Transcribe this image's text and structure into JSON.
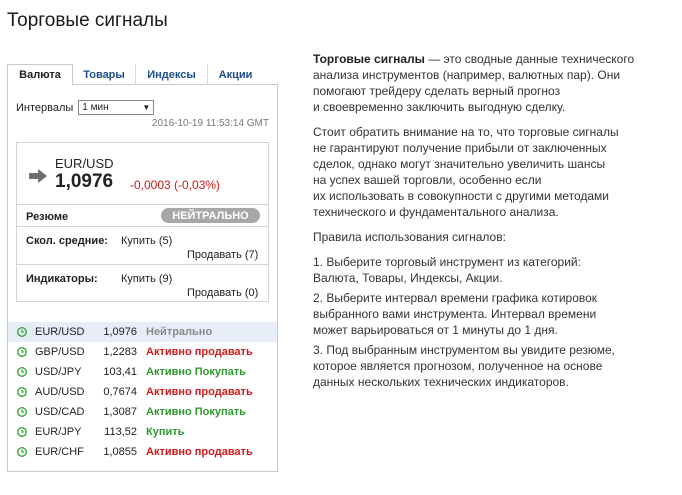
{
  "page_title": "Торговые сигналы",
  "tabs": [
    {
      "label": "Валюта",
      "active": true
    },
    {
      "label": "Товары",
      "active": false
    },
    {
      "label": "Индексы",
      "active": false
    },
    {
      "label": "Акции",
      "active": false
    }
  ],
  "interval": {
    "label": "Интервалы",
    "selected": "1 мин"
  },
  "timestamp": "2016-10-19 11:53:14 GMT",
  "quote": {
    "pair": "EUR/USD",
    "price": "1,0976",
    "change": "-0,0003 (-0,03%)",
    "arrow_icon": "arrow-right-icon"
  },
  "summary": {
    "label": "Резюме",
    "value": "НЕЙТРАЛЬНО"
  },
  "moving_averages": {
    "label": "Скол. средние:",
    "buy": "Купить (5)",
    "sell": "Продавать (7)"
  },
  "indicators": {
    "label": "Индикаторы:",
    "buy": "Купить (9)",
    "sell": "Продавать (0)"
  },
  "instruments": [
    {
      "symbol": "EUR/USD",
      "price": "1,0976",
      "signal": "Нейтрально",
      "color": "#8a8a8a"
    },
    {
      "symbol": "GBP/USD",
      "price": "1,2283",
      "signal": "Активно продавать",
      "color": "#d11a1a"
    },
    {
      "symbol": "USD/JPY",
      "price": "103,41",
      "signal": "Активно Покупать",
      "color": "#2e9a2e"
    },
    {
      "symbol": "AUD/USD",
      "price": "0,7674",
      "signal": "Активно продавать",
      "color": "#d11a1a"
    },
    {
      "symbol": "USD/CAD",
      "price": "1,3087",
      "signal": "Активно Покупать",
      "color": "#2e9a2e"
    },
    {
      "symbol": "EUR/JPY",
      "price": "113,52",
      "signal": "Купить",
      "color": "#2e9a2e"
    },
    {
      "symbol": "EUR/CHF",
      "price": "1,0855",
      "signal": "Активно продавать",
      "color": "#d11a1a"
    }
  ],
  "description": {
    "p1_strong": "Торговые сигналы",
    "p1_lines": [
      " — это сводные данные технического",
      "анализа инструментов (например, валютных пар). Они",
      "помогают трейдеру сделать верный прогноз",
      "и своевременно заключить выгодную сделку."
    ],
    "p2_lines": [
      "Стоит обратить внимание на то, что торговые сигналы",
      "не гарантируют получение прибыли от заключенных",
      "сделок, однако могут значительно увеличить шансы",
      "на успех вашей торговли, особенно если",
      "их использовать в совокупности с другими методами",
      "технического и фундаментального анализа."
    ],
    "p3": "Правила использования сигналов:",
    "rule1_lines": [
      "1. Выберите торговый инструмент из категорий:",
      "Валюта, Товары, Индексы, Акции."
    ],
    "rule2_lines": [
      "2. Выберите интервал времени графика котировок",
      "выбранного вами инструмента. Интервал времени",
      "может варьироваться от 1 минуты до 1 дня."
    ],
    "rule3_lines": [
      "3. Под выбранным инструментом вы увидите резюме,",
      "которое является прогнозом, полученное на основе",
      "данных нескольких технических индикаторов."
    ]
  }
}
